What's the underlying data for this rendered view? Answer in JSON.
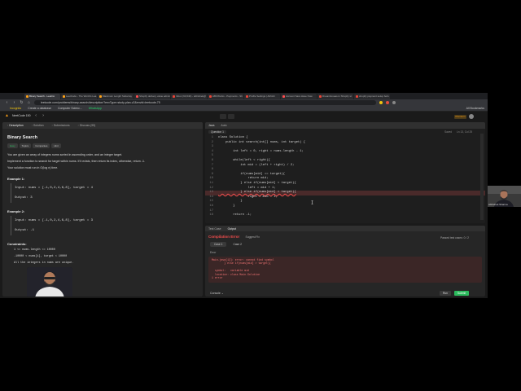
{
  "browser": {
    "tabs": [
      {
        "label": "Binary Search - LeetCo",
        "active": true,
        "favicon_color": "#ffa116"
      },
      {
        "label": "LeetCode - The World's Lea",
        "active": false,
        "favicon_color": "#ffa116"
      },
      {
        "label": "Maximum Length Subarray",
        "active": false,
        "favicon_color": "#ffa116"
      },
      {
        "label": "Shopify delivery value admin",
        "active": false,
        "favicon_color": "#ff4d4d"
      },
      {
        "label": "Inbox (93,640) - abhishek@",
        "active": false,
        "favicon_color": "#ea4335"
      },
      {
        "label": "ABCWorks - Payments - Sh",
        "active": false,
        "favicon_color": "#ea4335"
      },
      {
        "label": "Profile Settings | Abhish",
        "active": false,
        "favicon_color": "#ea4335"
      },
      {
        "label": "Account Sara Have Now",
        "active": false,
        "favicon_color": "#ff4d4d"
      },
      {
        "label": "Dreamboxeas.in Shopify st",
        "active": false,
        "favicon_color": "#ea4335"
      },
      {
        "label": "shopify payment setup befo",
        "active": false,
        "favicon_color": "#ea4335"
      }
    ],
    "url": "leetcode.com/problems/binary-search/description/?envType=study-plan-v2&envId=leetcode-75",
    "bookmarks": [
      "Incognito",
      "Create a database",
      "Computer Scienc...",
      "WhatsApp"
    ],
    "all_bookmarks": "All Bookmarks"
  },
  "leetcode": {
    "brand": "NeetCode 150",
    "premium": "Premium",
    "left_tabs": [
      "Description",
      "Solution",
      "Submissions",
      "Discuss (95)"
    ],
    "title": "Binary Search",
    "tags": [
      "Easy",
      "Topics",
      "Companies",
      "Hint"
    ],
    "description": [
      "You are given an array of integers nums sorted in ascending order, and an integer target.",
      "Implement a function to search for target within nums. If it exists, then return its index, otherwise, return -1.",
      "Your solution must run in O(log n) time."
    ],
    "examples": [
      {
        "title": "Example 1:",
        "input": "Input: nums = [-1,0,2,4,6,8], target = 4",
        "output": "Output: 3"
      },
      {
        "title": "Example 2:",
        "input": "Input: nums = [-1,0,2,4,6,8], target = 3",
        "output": "Output: -1"
      }
    ],
    "constraints_title": "Constraints:",
    "constraints": [
      "1 <= nums.length <= 10000",
      "-10000 < nums[i], target < 10000",
      "All the integers in nums are unique."
    ]
  },
  "editor": {
    "tabs": [
      "Java",
      "Auto"
    ],
    "toolbar": [
      "Question 1",
      "Saved",
      "Saved",
      "Ln 13, Col 25"
    ],
    "lines": [
      {
        "n": "1",
        "text": "class Solution {"
      },
      {
        "n": "2",
        "text": "    public int search(int[] nums, int target) {"
      },
      {
        "n": "3",
        "text": ""
      },
      {
        "n": "4",
        "text": "        int left = 0, right = nums.length - 1;"
      },
      {
        "n": "5",
        "text": ""
      },
      {
        "n": "6",
        "text": "        while(left < right){"
      },
      {
        "n": "7",
        "text": "            int mid = (left + right) / 2;"
      },
      {
        "n": "8",
        "text": ""
      },
      {
        "n": "9",
        "text": "            if(nums[mid] == target){"
      },
      {
        "n": "10",
        "text": "                return mid;"
      },
      {
        "n": "11",
        "text": "            } else if(nums[mid] < target){"
      },
      {
        "n": "12",
        "text": "                left = mid + 1;"
      },
      {
        "n": "13",
        "text": "            } else if(nums[mid] > target){",
        "error": true
      },
      {
        "n": "14",
        "text": "                right = mid - 1;"
      },
      {
        "n": "15",
        "text": "            }"
      },
      {
        "n": "16",
        "text": "        }"
      },
      {
        "n": "17",
        "text": ""
      },
      {
        "n": "18",
        "text": "        return -1;"
      }
    ]
  },
  "console": {
    "tabs": [
      "Test Case",
      "Output"
    ],
    "status": "Compilation Error",
    "suggest": "Suggest Fix",
    "passed": "Passed test cases: 0 / 2",
    "cases": [
      "Case 1",
      "Case 2"
    ],
    "error_label": "Error",
    "error_lines": [
      "Main.java[13]: error: cannot find symbol",
      "        } else if(nums[mid] > target){",
      "",
      "  symbol:   variable mid",
      "  location: class Main.Solution",
      "1 error"
    ],
    "footer_console": "Console ⌄",
    "run": "Run",
    "submit": "Submit"
  },
  "participant": {
    "name": "Abhishek Sharma"
  }
}
